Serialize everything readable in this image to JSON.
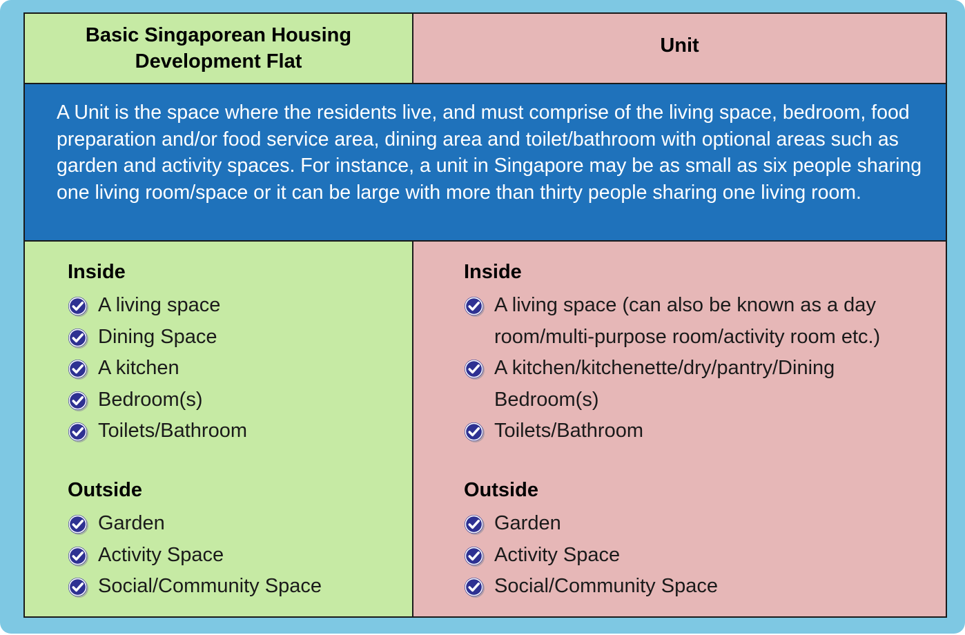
{
  "header": {
    "left_title": "Basic Singaporean Housing Development Flat",
    "right_title": "Unit"
  },
  "description": "A Unit is the space where the residents live, and must comprise of the living space, bedroom, food preparation and/or food service area, dining area and toilet/bathroom with optional areas such as garden and activity spaces. For instance, a unit in Singapore may be as small as six people sharing one living room/space or it can be large with more than thirty people sharing one living room.",
  "left": {
    "inside_title": "Inside",
    "inside_items": [
      "A living space",
      "Dining Space",
      "A kitchen",
      "Bedroom(s)",
      "Toilets/Bathroom"
    ],
    "outside_title": "Outside",
    "outside_items": [
      "Garden",
      "Activity Space",
      "Social/Community Space"
    ]
  },
  "right": {
    "inside_title": "Inside",
    "inside_items": [
      "A living space (can also be known as a day room/multi-purpose room/activity room etc.)",
      "A kitchen/kitchenette/dry/pantry/Dining Bedroom(s)",
      "Toilets/Bathroom"
    ],
    "outside_title": "Outside",
    "outside_items": [
      "Garden",
      "Activity Space",
      "Social/Community Space"
    ]
  },
  "colors": {
    "frame": "#7ec8e3",
    "green_cell": "#c6eaa4",
    "pink_cell": "#e6b7b7",
    "blue_band": "#1f72bb",
    "check_icon": "#2e3192"
  },
  "icons": {
    "bullet": "check-circle-icon"
  }
}
